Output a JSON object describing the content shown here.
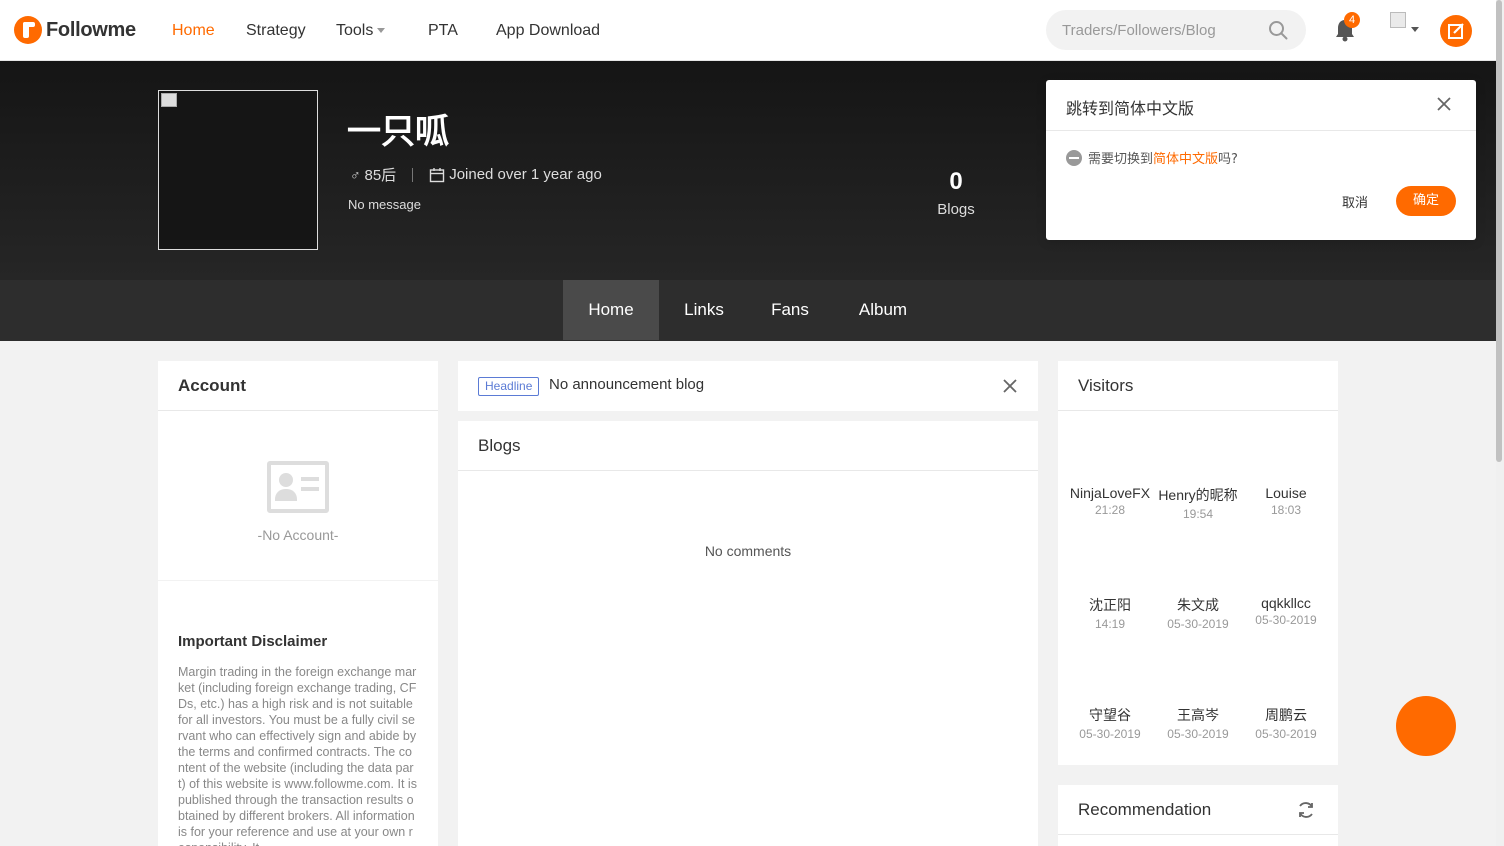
{
  "header": {
    "logo_text": "Followme",
    "nav": [
      "Home",
      "Strategy",
      "Tools",
      "PTA",
      "App Download"
    ],
    "search_placeholder": "Traders/Followers/Blog",
    "notification_count": "4"
  },
  "profile": {
    "name": "一只呱",
    "gender_age": "85后",
    "joined": "Joined over 1 year ago",
    "message": "No message",
    "blogs_count": "0",
    "blogs_label": "Blogs"
  },
  "tabs": [
    "Home",
    "Links",
    "Fans",
    "Album"
  ],
  "popup": {
    "title": "跳转到简体中文版",
    "msg_before": "需要切换到",
    "msg_highlight": "简体中文版",
    "msg_after": "吗?",
    "cancel": "取消",
    "ok": "确定"
  },
  "account": {
    "title": "Account",
    "empty": "-No Account-"
  },
  "disclaimer": {
    "title": "Important Disclaimer",
    "text": "Margin trading in the foreign exchange market (including foreign exchange trading, CFDs, etc.) has a high risk and is not suitable for all investors. You must be a fully civil servant who can effectively sign and abide by the terms and confirmed contracts. The content of the website (including the data part) of this website is www.followme.com. It is published through the transaction results obtained by different brokers. All information is for your reference and use at your own responsibility. It"
  },
  "announcement": {
    "tag": "Headline",
    "text": "No announcement blog"
  },
  "blogs_section": {
    "title": "Blogs",
    "empty": "No comments"
  },
  "visitors": {
    "title": "Visitors",
    "items": [
      {
        "name": "NinjaLoveFX",
        "time": "21:28"
      },
      {
        "name": "Henry的昵称",
        "time": "19:54"
      },
      {
        "name": "Louise",
        "time": "18:03"
      },
      {
        "name": "沈正阳",
        "time": "14:19"
      },
      {
        "name": "朱文成",
        "time": "05-30-2019"
      },
      {
        "name": "qqkkllcc",
        "time": "05-30-2019"
      },
      {
        "name": "守望谷",
        "time": "05-30-2019"
      },
      {
        "name": "王高岑",
        "time": "05-30-2019"
      },
      {
        "name": "周鹏云",
        "time": "05-30-2019"
      }
    ]
  },
  "recommendation": {
    "title": "Recommendation"
  },
  "colors": {
    "accent": "#ff6a00",
    "banner": "#1c1c1c",
    "tabbar": "#2d2d2d",
    "tag_blue": "#5b7bd5"
  }
}
